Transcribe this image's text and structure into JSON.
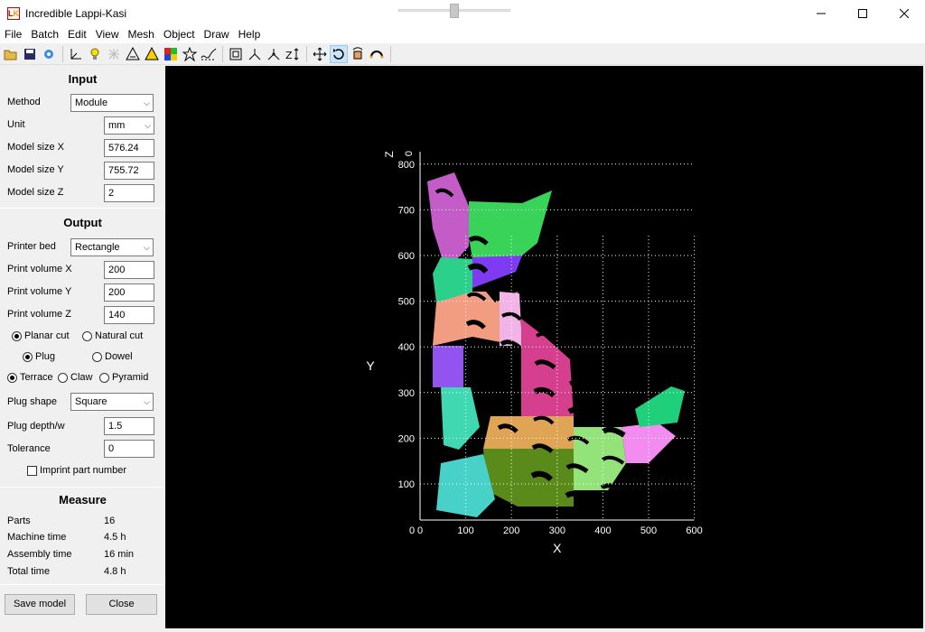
{
  "window": {
    "title": "Incredible Lappi-Kasi",
    "icon_text": "LK",
    "controls": [
      "minimize-icon",
      "maximize-icon",
      "close-icon"
    ]
  },
  "menu": [
    "File",
    "Batch",
    "Edit",
    "View",
    "Mesh",
    "Object",
    "Draw",
    "Help"
  ],
  "toolbar_icons": [
    "open-folder-icon",
    "save-icon",
    "import-icon",
    "axes-icon",
    "light-bulb-icon",
    "grid-icon",
    "warning-icon",
    "colors-icon",
    "color-map-icon",
    "star-icon",
    "wave-icon",
    "frame-icon",
    "axis-x-icon",
    "axis-y-icon",
    "axis-z-icon",
    "move-icon",
    "rotate-icon",
    "transform-icon",
    "arc-icon"
  ],
  "input": {
    "title": "Input",
    "method_label": "Method",
    "method_value": "Module",
    "unit_label": "Unit",
    "unit_value": "mm",
    "size_x_label": "Model size X",
    "size_x_value": "576.24",
    "size_y_label": "Model size Y",
    "size_y_value": "755.72",
    "size_z_label": "Model size Z",
    "size_z_value": "2"
  },
  "output": {
    "title": "Output",
    "bed_label": "Printer bed",
    "bed_value": "Rectangle",
    "vol_x_label": "Print volume X",
    "vol_x_value": "200",
    "vol_y_label": "Print volume Y",
    "vol_y_value": "200",
    "vol_z_label": "Print volume Z",
    "vol_z_value": "140",
    "planar_cut": "Planar cut",
    "natural_cut": "Natural cut",
    "plug": "Plug",
    "dowel": "Dowel",
    "terrace": "Terrace",
    "claw": "Claw",
    "pyramid": "Pyramid",
    "plug_shape_label": "Plug shape",
    "plug_shape_value": "Square",
    "plug_depth_label": "Plug depth/w",
    "plug_depth_value": "1.5",
    "tolerance_label": "Tolerance",
    "tolerance_value": "0",
    "imprint_label": "Imprint part number"
  },
  "measure": {
    "title": "Measure",
    "parts_label": "Parts",
    "parts_value": "16",
    "machine_label": "Machine time",
    "machine_value": "4.5 h",
    "assembly_label": "Assembly time",
    "assembly_value": "16 min",
    "total_label": "Total time",
    "total_value": "4.8 h"
  },
  "buttons": {
    "save": "Save model",
    "close": "Close"
  },
  "plot": {
    "x_axis_label": "X",
    "y_axis_label": "Y",
    "z_axis_label": "Z",
    "z_value": "0",
    "x_ticks": [
      "0",
      "100",
      "200",
      "300",
      "400",
      "500",
      "600"
    ],
    "origin_x_extra": "0",
    "y_ticks": [
      "100",
      "200",
      "300",
      "400",
      "500",
      "600",
      "700",
      "800"
    ],
    "grid_color": "#ffffff",
    "part_colors": [
      "#c35cc6",
      "#3ad35a",
      "#2bd18a",
      "#7f3bf1",
      "#f29c82",
      "#f2b3e6",
      "#9353f0",
      "#40d8b0",
      "#d63f8d",
      "#e0a455",
      "#5a8a1a",
      "#93e27a",
      "#47d1c8",
      "#f28cf0",
      "#1fcf7a",
      "#5ce05c"
    ]
  }
}
